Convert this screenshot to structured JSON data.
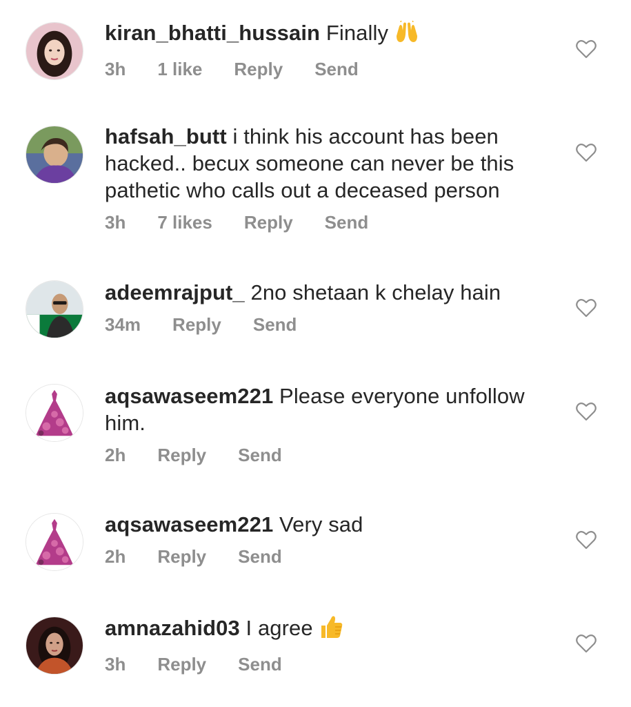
{
  "comments": [
    {
      "username": "kiran_bhatti_hussain",
      "text": "Finally",
      "emoji": "raising-hands-emoji",
      "time": "3h",
      "likes": "1 like",
      "reply_label": "Reply",
      "send_label": "Send",
      "avatar": "avatar-woman-pink-background"
    },
    {
      "username": "hafsah_butt",
      "text": "i think his account has been hacked.. becux someone can never be this pathetic who calls out a deceased person",
      "time": "3h",
      "likes": "7 likes",
      "reply_label": "Reply",
      "send_label": "Send",
      "avatar": "avatar-woman-outdoor"
    },
    {
      "username": "adeemrajput_",
      "text": "2no shetaan k chelay hain",
      "time": "34m",
      "reply_label": "Reply",
      "send_label": "Send",
      "avatar": "avatar-man-flag"
    },
    {
      "username": "aqsawaseem221",
      "text": "Please everyone unfollow him.",
      "time": "2h",
      "reply_label": "Reply",
      "send_label": "Send",
      "avatar": "avatar-flower-dress"
    },
    {
      "username": "aqsawaseem221",
      "text": "Very sad",
      "time": "2h",
      "reply_label": "Reply",
      "send_label": "Send",
      "avatar": "avatar-flower-dress"
    },
    {
      "username": "amnazahid03",
      "text": "I agree",
      "emoji": "thumbs-up-emoji",
      "time": "3h",
      "reply_label": "Reply",
      "send_label": "Send",
      "avatar": "avatar-woman-dark"
    }
  ],
  "icons": {
    "like": "heart-outline-icon"
  },
  "colors": {
    "text": "#262626",
    "meta": "#8e8e8e",
    "icon": "#8e8e8e"
  }
}
